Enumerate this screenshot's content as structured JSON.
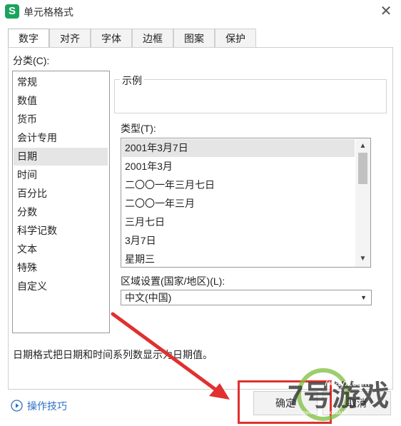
{
  "window": {
    "title": "单元格格式",
    "app_icon_letter": "S"
  },
  "tabs": [
    {
      "label": "数字",
      "active": true
    },
    {
      "label": "对齐"
    },
    {
      "label": "字体"
    },
    {
      "label": "边框"
    },
    {
      "label": "图案"
    },
    {
      "label": "保护"
    }
  ],
  "category": {
    "label": "分类(C):",
    "items": [
      "常规",
      "数值",
      "货币",
      "会计专用",
      "日期",
      "时间",
      "百分比",
      "分数",
      "科学记数",
      "文本",
      "特殊",
      "自定义"
    ],
    "selected": "日期"
  },
  "sample": {
    "label": "示例"
  },
  "type": {
    "label": "类型(T):",
    "items": [
      "2001年3月7日",
      "2001年3月",
      "二〇〇一年三月七日",
      "二〇〇一年三月",
      "三月七日",
      "3月7日",
      "星期三"
    ],
    "selected": "2001年3月7日"
  },
  "locale": {
    "label": "区域设置(国家/地区)(L):",
    "value": "中文(中国)"
  },
  "description": "日期格式把日期和时间系列数显示为日期值。",
  "tips": {
    "label": "操作技巧"
  },
  "buttons": {
    "ok": "确定",
    "cancel": "取消"
  },
  "watermark": {
    "big": "7号游戏",
    "sub": "QIHAOYOUXIWANG",
    "url": "7xiayx.com"
  },
  "colors": {
    "annotation": "#e03030",
    "link": "#2b6fc4",
    "app_icon": "#1aa35d",
    "watermark": "#7fbf3f"
  }
}
